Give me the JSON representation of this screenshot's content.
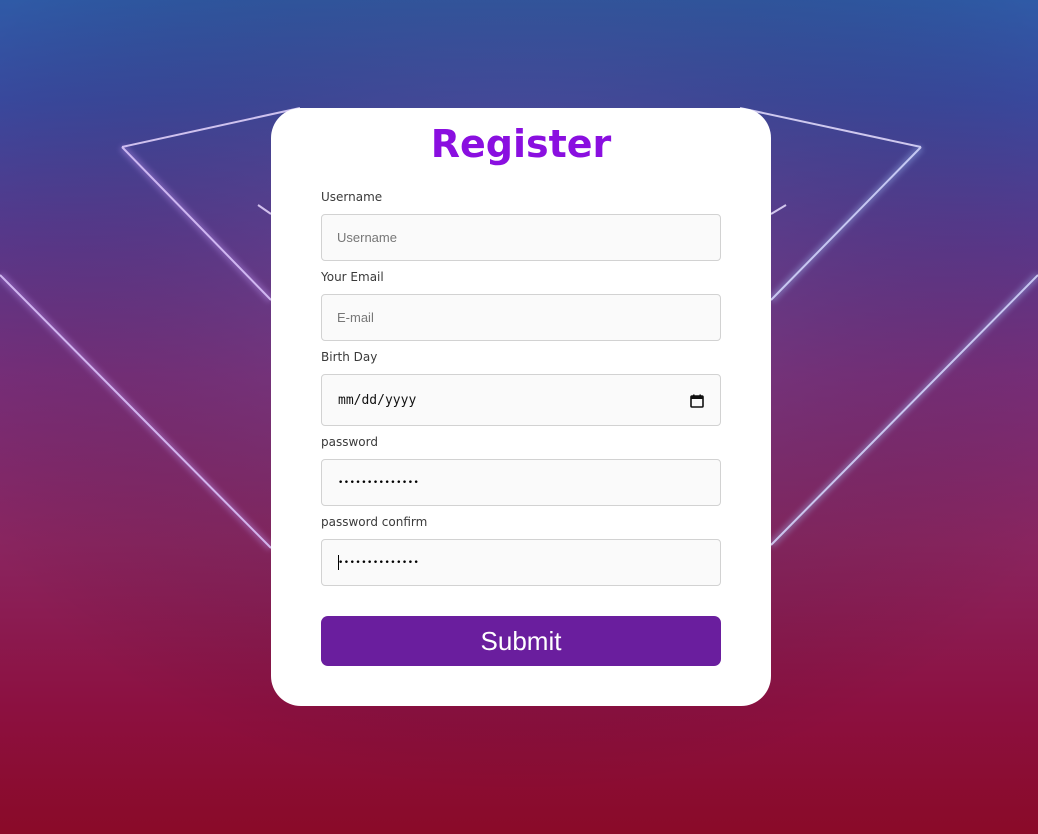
{
  "page": {
    "title": "Register",
    "title_color": "#8a0fe0"
  },
  "form": {
    "username": {
      "label": "Username",
      "placeholder": "Username",
      "value": ""
    },
    "email": {
      "label": "Your Email",
      "placeholder": "E-mail",
      "value": ""
    },
    "birthday": {
      "label": "Birth Day",
      "placeholder": "mm/dd/yyyy",
      "icon": "calendar-icon"
    },
    "password": {
      "label": "password",
      "masked_value": "••••••••••••••"
    },
    "password_confirm": {
      "label": "password confirm",
      "masked_value": "••••••••••••••"
    },
    "submit": {
      "label": "Submit",
      "color": "#6a1e9e"
    }
  }
}
